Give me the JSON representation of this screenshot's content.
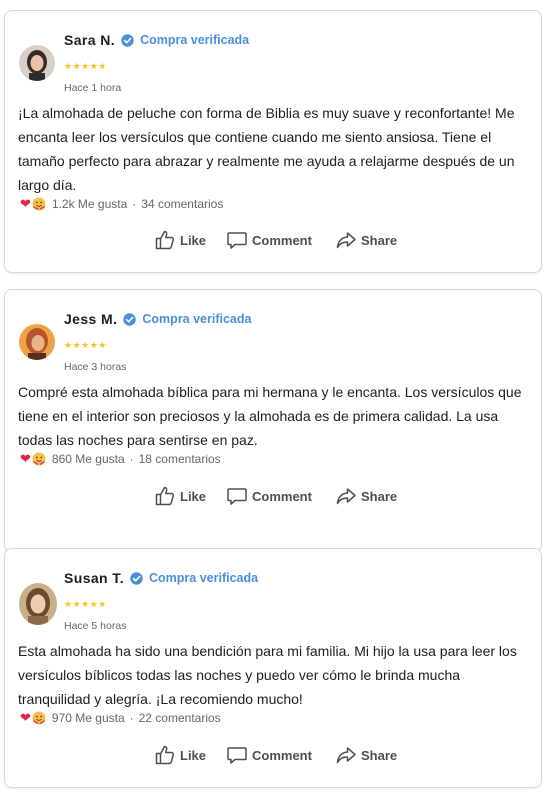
{
  "reviews": [
    {
      "name": "Sara N.",
      "verified_label": "Compra verificada",
      "stars": "★★★★★",
      "time": "Hace 1 hora",
      "text": "¡La almohada de peluche con forma de Biblia es muy suave y reconfortante! Me encanta leer los versículos que contiene cuando me siento ansiosa. Tiene el tamaño perfecto para abrazar y realmente me ayuda a relajarme después de un largo día.",
      "likes": "1.2k Me gusta",
      "comments": "34 comentarios"
    },
    {
      "name": "Jess M.",
      "verified_label": "Compra verificada",
      "stars": "★★★★★",
      "time": "Hace 3 horas",
      "text": "Compré esta almohada bíblica para mi hermana y le encanta. Los versículos que tiene en el interior son preciosos y la almohada es de primera calidad. La usa todas las noches para sentirse en paz.",
      "likes": "860 Me gusta",
      "comments": "18 comentarios"
    },
    {
      "name": "Susan T.",
      "verified_label": "Compra verificada",
      "stars": "★★★★★",
      "time": "Hace 5 horas",
      "text": "Esta almohada ha sido una bendición para mi familia. Mi hijo la usa para leer los versículos bíblicos todas las noches y puedo ver cómo le brinda mucha tranquilidad y alegría. ¡La recomiendo mucho!",
      "likes": "970 Me gusta",
      "comments": "22 comentarios"
    }
  ],
  "actions": {
    "like": "Like",
    "comment": "Comment",
    "share": "Share"
  },
  "reaction_separator": "·",
  "colors": {
    "verified": "#4a90d9",
    "stars": "#f5c518",
    "heart": "#e5243b",
    "muted": "#65676b"
  },
  "icons": [
    "verified-check-icon",
    "heart-icon",
    "hug-emoji-icon",
    "thumbs-up-icon",
    "comment-bubble-icon",
    "share-arrow-icon"
  ]
}
